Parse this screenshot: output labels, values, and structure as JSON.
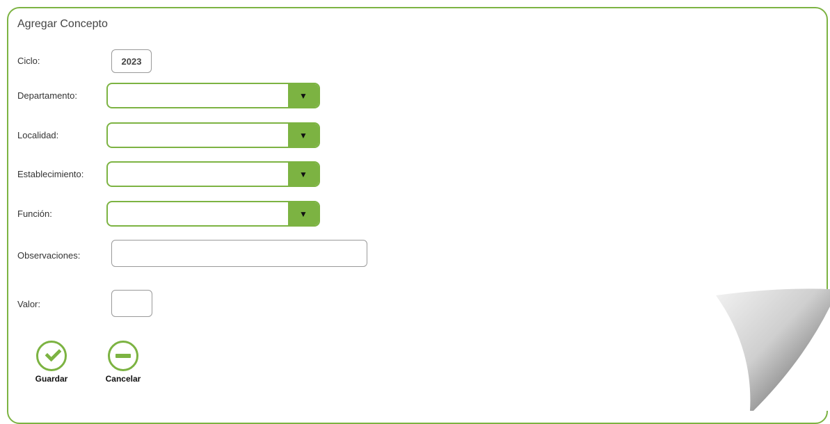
{
  "form": {
    "title": "Agregar Concepto",
    "ciclo_label": "Ciclo:",
    "ciclo_value": "2023",
    "departamento_label": "Departamento:",
    "localidad_label": "Localidad:",
    "establecimiento_label": "Establecimiento:",
    "funcion_label": "Función:",
    "observaciones_label": "Observaciones:",
    "valor_label": "Valor:"
  },
  "actions": {
    "guardar_label": "Guardar",
    "cancelar_label": "Cancelar"
  },
  "colors": {
    "accent": "#7cb342"
  }
}
